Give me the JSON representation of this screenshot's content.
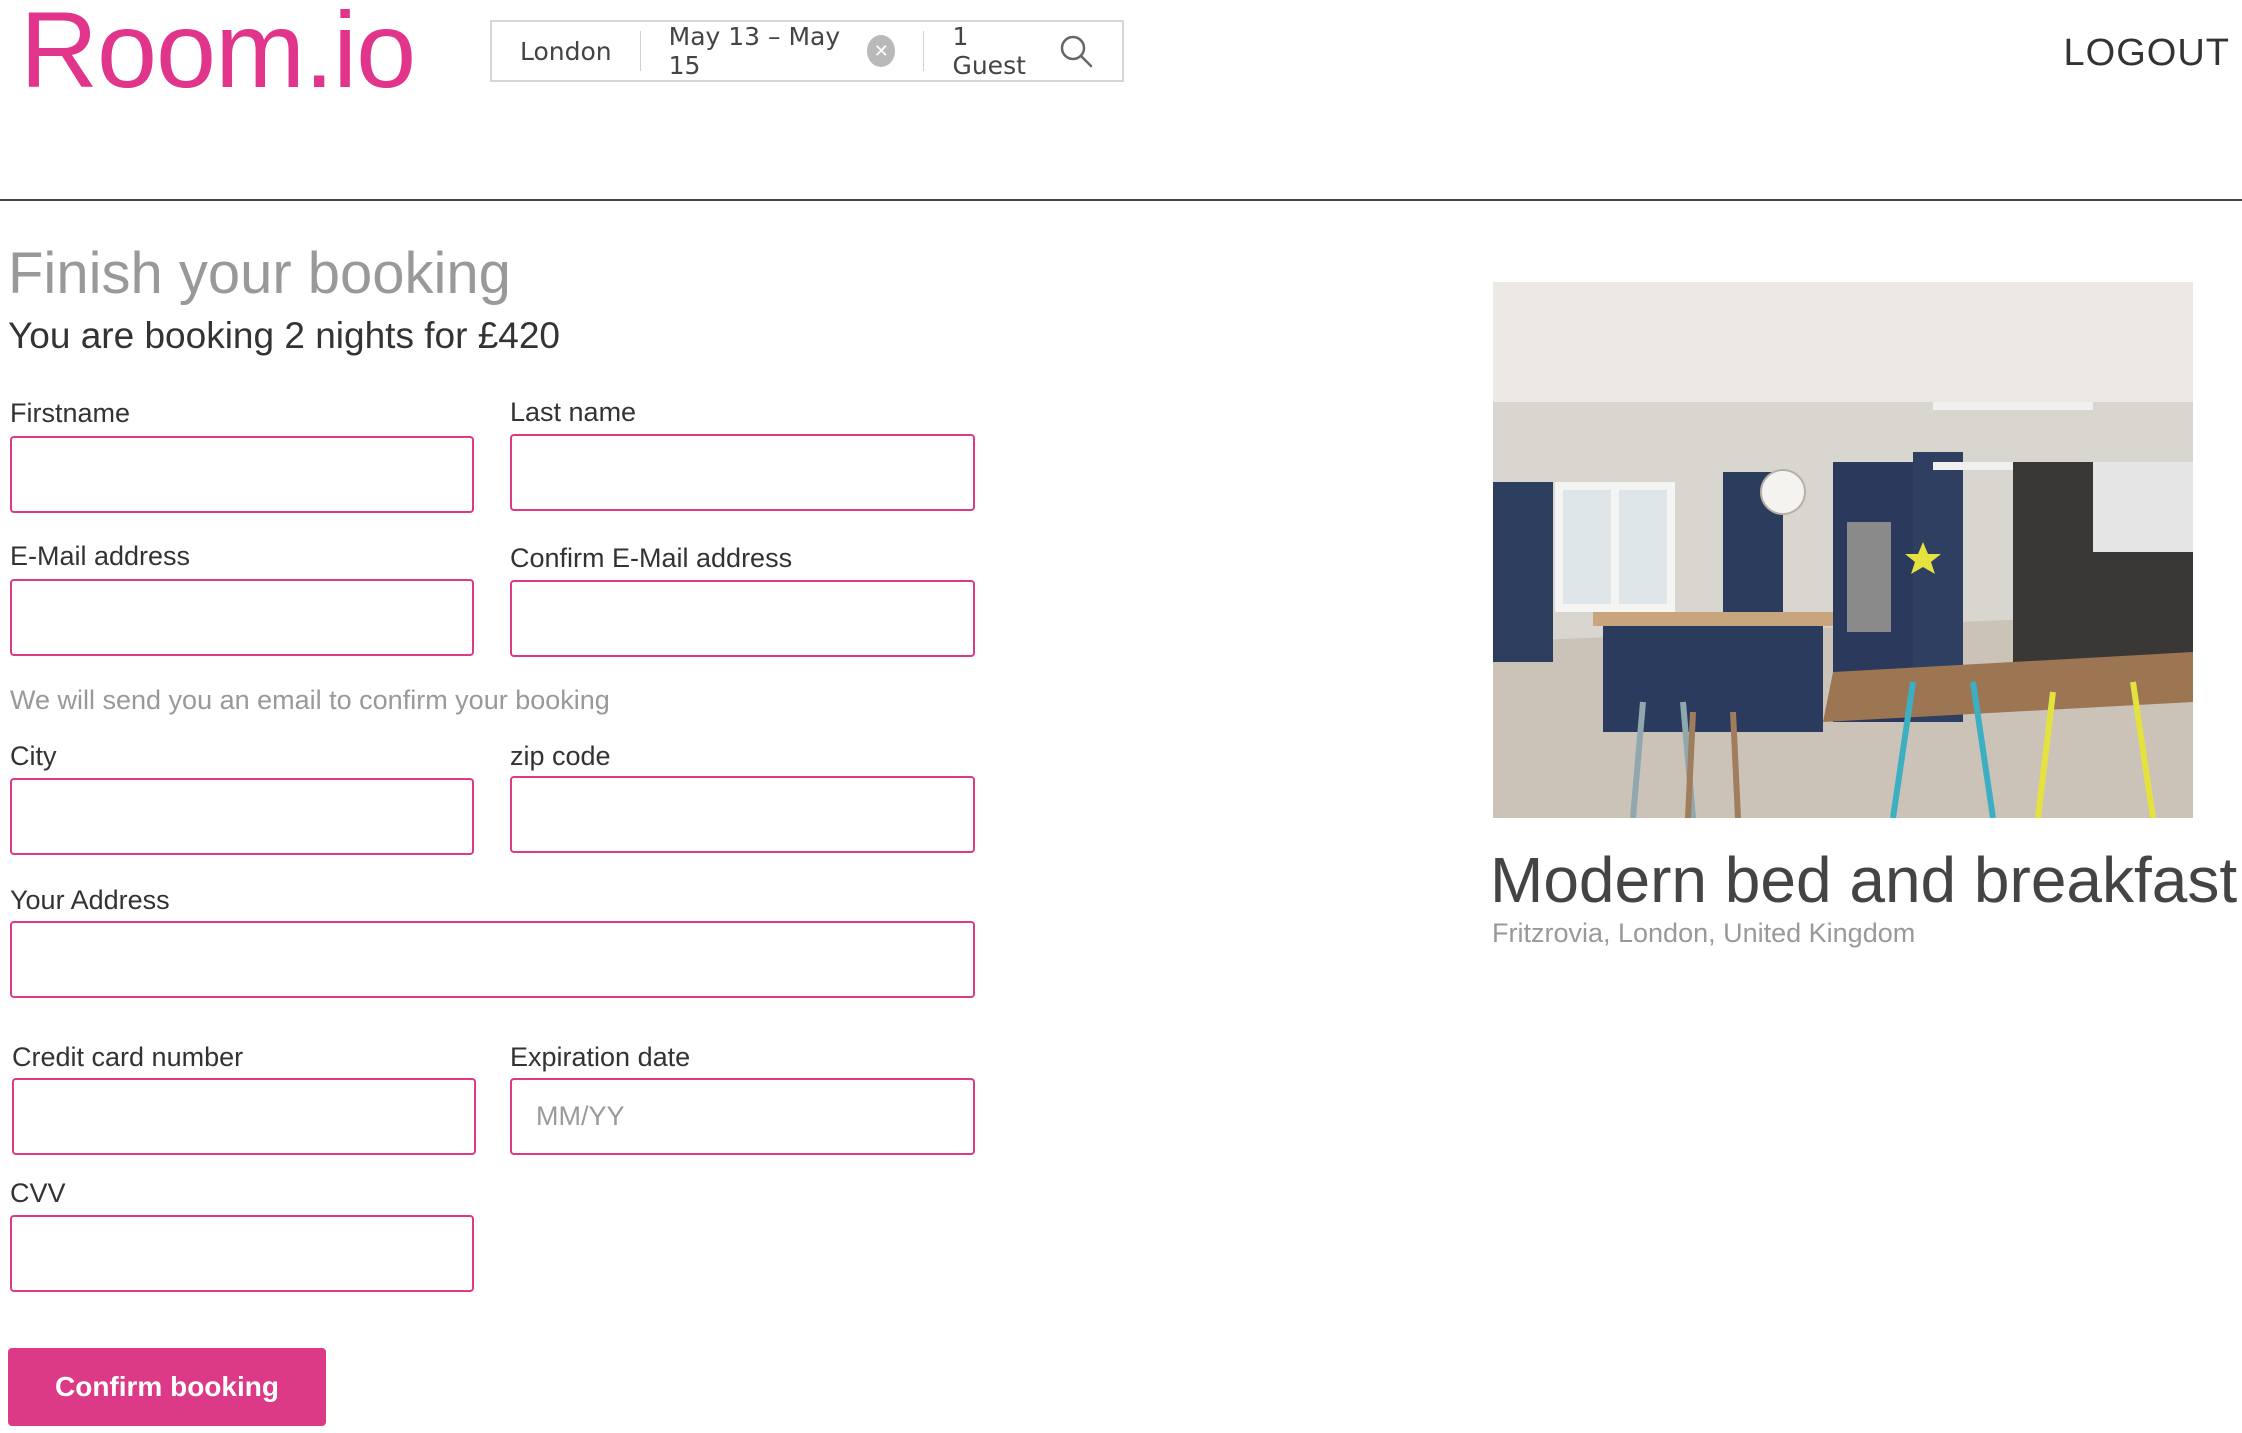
{
  "header": {
    "logo": "Room.io",
    "search": {
      "location": "London",
      "dates": "May 13 – May 15",
      "guests": "1 Guest"
    },
    "logout_label": "LOGOUT"
  },
  "booking": {
    "title": "Finish your booking",
    "summary": "You are booking 2 nights for £420",
    "fields": {
      "firstname_label": "Firstname",
      "lastname_label": "Last name",
      "email_label": "E-Mail address",
      "confirm_email_label": "Confirm E-Mail address",
      "email_note": "We will send you an email to confirm your booking",
      "city_label": "City",
      "zip_label": "zip code",
      "address_label": "Your Address",
      "card_label": "Credit card number",
      "expiry_label": "Expiration date",
      "expiry_placeholder": "MM/YY",
      "cvv_label": "CVV"
    },
    "confirm_label": "Confirm booking"
  },
  "listing": {
    "title": "Modern bed and breakfast",
    "location": "Fritzrovia, London, United Kingdom"
  },
  "colors": {
    "brand": "#e0358a",
    "input_border": "#dc3a86"
  }
}
